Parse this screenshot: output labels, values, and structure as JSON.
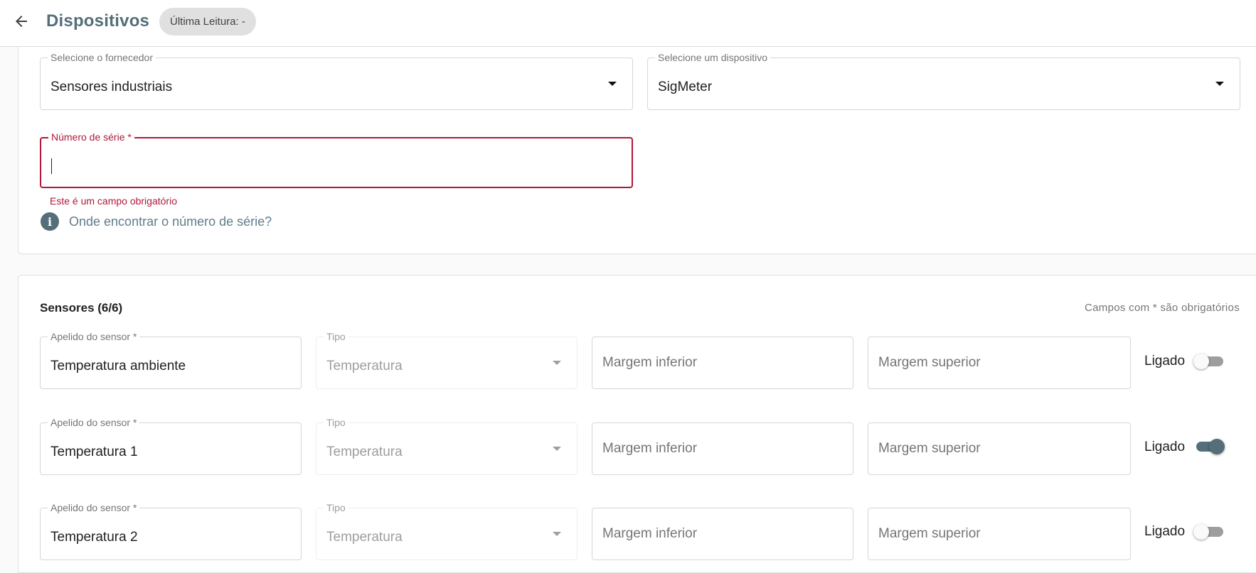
{
  "header": {
    "title": "Dispositivos",
    "last_reading": "Última Leitura: -"
  },
  "device": {
    "supplier_label": "Selecione o fornecedor",
    "supplier_value": "Sensores industriais",
    "device_label": "Selecione um dispositivo",
    "device_value": "SigMeter",
    "serial_label": "Número de série *",
    "serial_value": "",
    "serial_error": "Este é um campo obrigatório",
    "serial_help": "Onde encontrar o número de série?"
  },
  "sensors": {
    "title": "Sensores (6/6)",
    "required_note": "Campos com * são obrigatórios",
    "nickname_label": "Apelido do sensor *",
    "type_label": "Tipo",
    "lower_placeholder": "Margem inferior",
    "upper_placeholder": "Margem superior",
    "toggle_label": "Ligado",
    "rows": [
      {
        "nickname": "Temperatura ambiente",
        "type": "Temperatura",
        "enabled": false
      },
      {
        "nickname": "Temperatura 1",
        "type": "Temperatura",
        "enabled": true
      },
      {
        "nickname": "Temperatura 2",
        "type": "Temperatura",
        "enabled": false
      }
    ]
  },
  "colors": {
    "accent": "#546e7a",
    "error": "#b0193a"
  },
  "icons": {
    "back": "arrow-left-icon",
    "dropdown": "caret-down-icon",
    "info": "info-icon"
  }
}
